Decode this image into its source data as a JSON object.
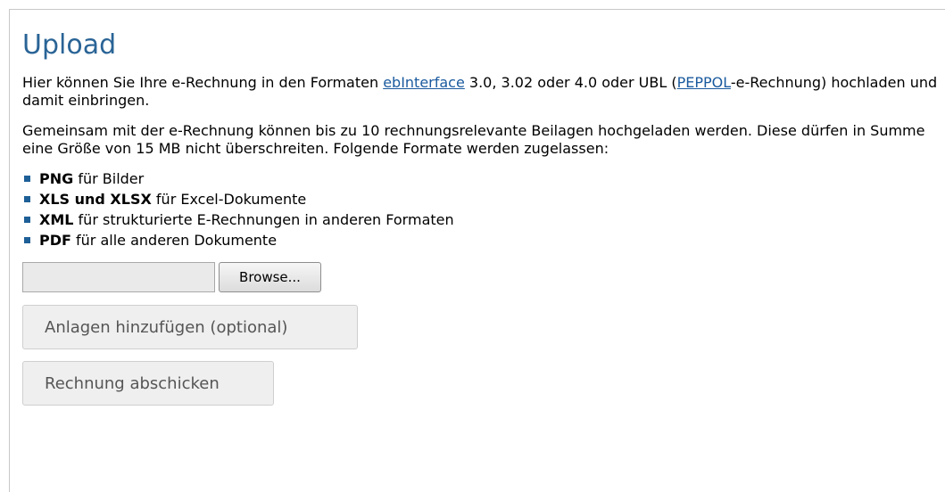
{
  "page": {
    "title": "Upload"
  },
  "intro": {
    "text_before_link1": "Hier können Sie Ihre e-Rechnung in den Formaten ",
    "link1_label": "ebInterface",
    "text_between_links": " 3.0, 3.02 oder 4.0 oder UBL (",
    "link2_label": "PEPPOL",
    "text_after_link2": "-e-Rechnung) hochladen und damit einbringen."
  },
  "attachments_info": "Gemeinsam mit der e-Rechnung können bis zu 10 rechnungsrelevante Beilagen hochgeladen werden. Diese dürfen in Summe eine Größe von 15 MB nicht überschreiten. Folgende Formate werden zugelassen:",
  "formats": [
    {
      "format": "PNG",
      "description": " für Bilder"
    },
    {
      "format": "XLS und XLSX",
      "description": " für Excel-Dokumente"
    },
    {
      "format": "XML",
      "description": " für strukturierte E-Rechnungen in anderen Formaten"
    },
    {
      "format": "PDF",
      "description": " für alle anderen Dokumente"
    }
  ],
  "file_input": {
    "value": "",
    "browse_label": "Browse..."
  },
  "buttons": {
    "add_attachments_label": "Anlagen hinzufügen (optional)",
    "submit_label": "Rechnung abschicken"
  },
  "colors": {
    "heading": "#2a6496",
    "link": "#1a5a9e",
    "bullet": "#1e5f97",
    "disabled_button_bg": "#efefef",
    "disabled_button_text": "#555555"
  }
}
